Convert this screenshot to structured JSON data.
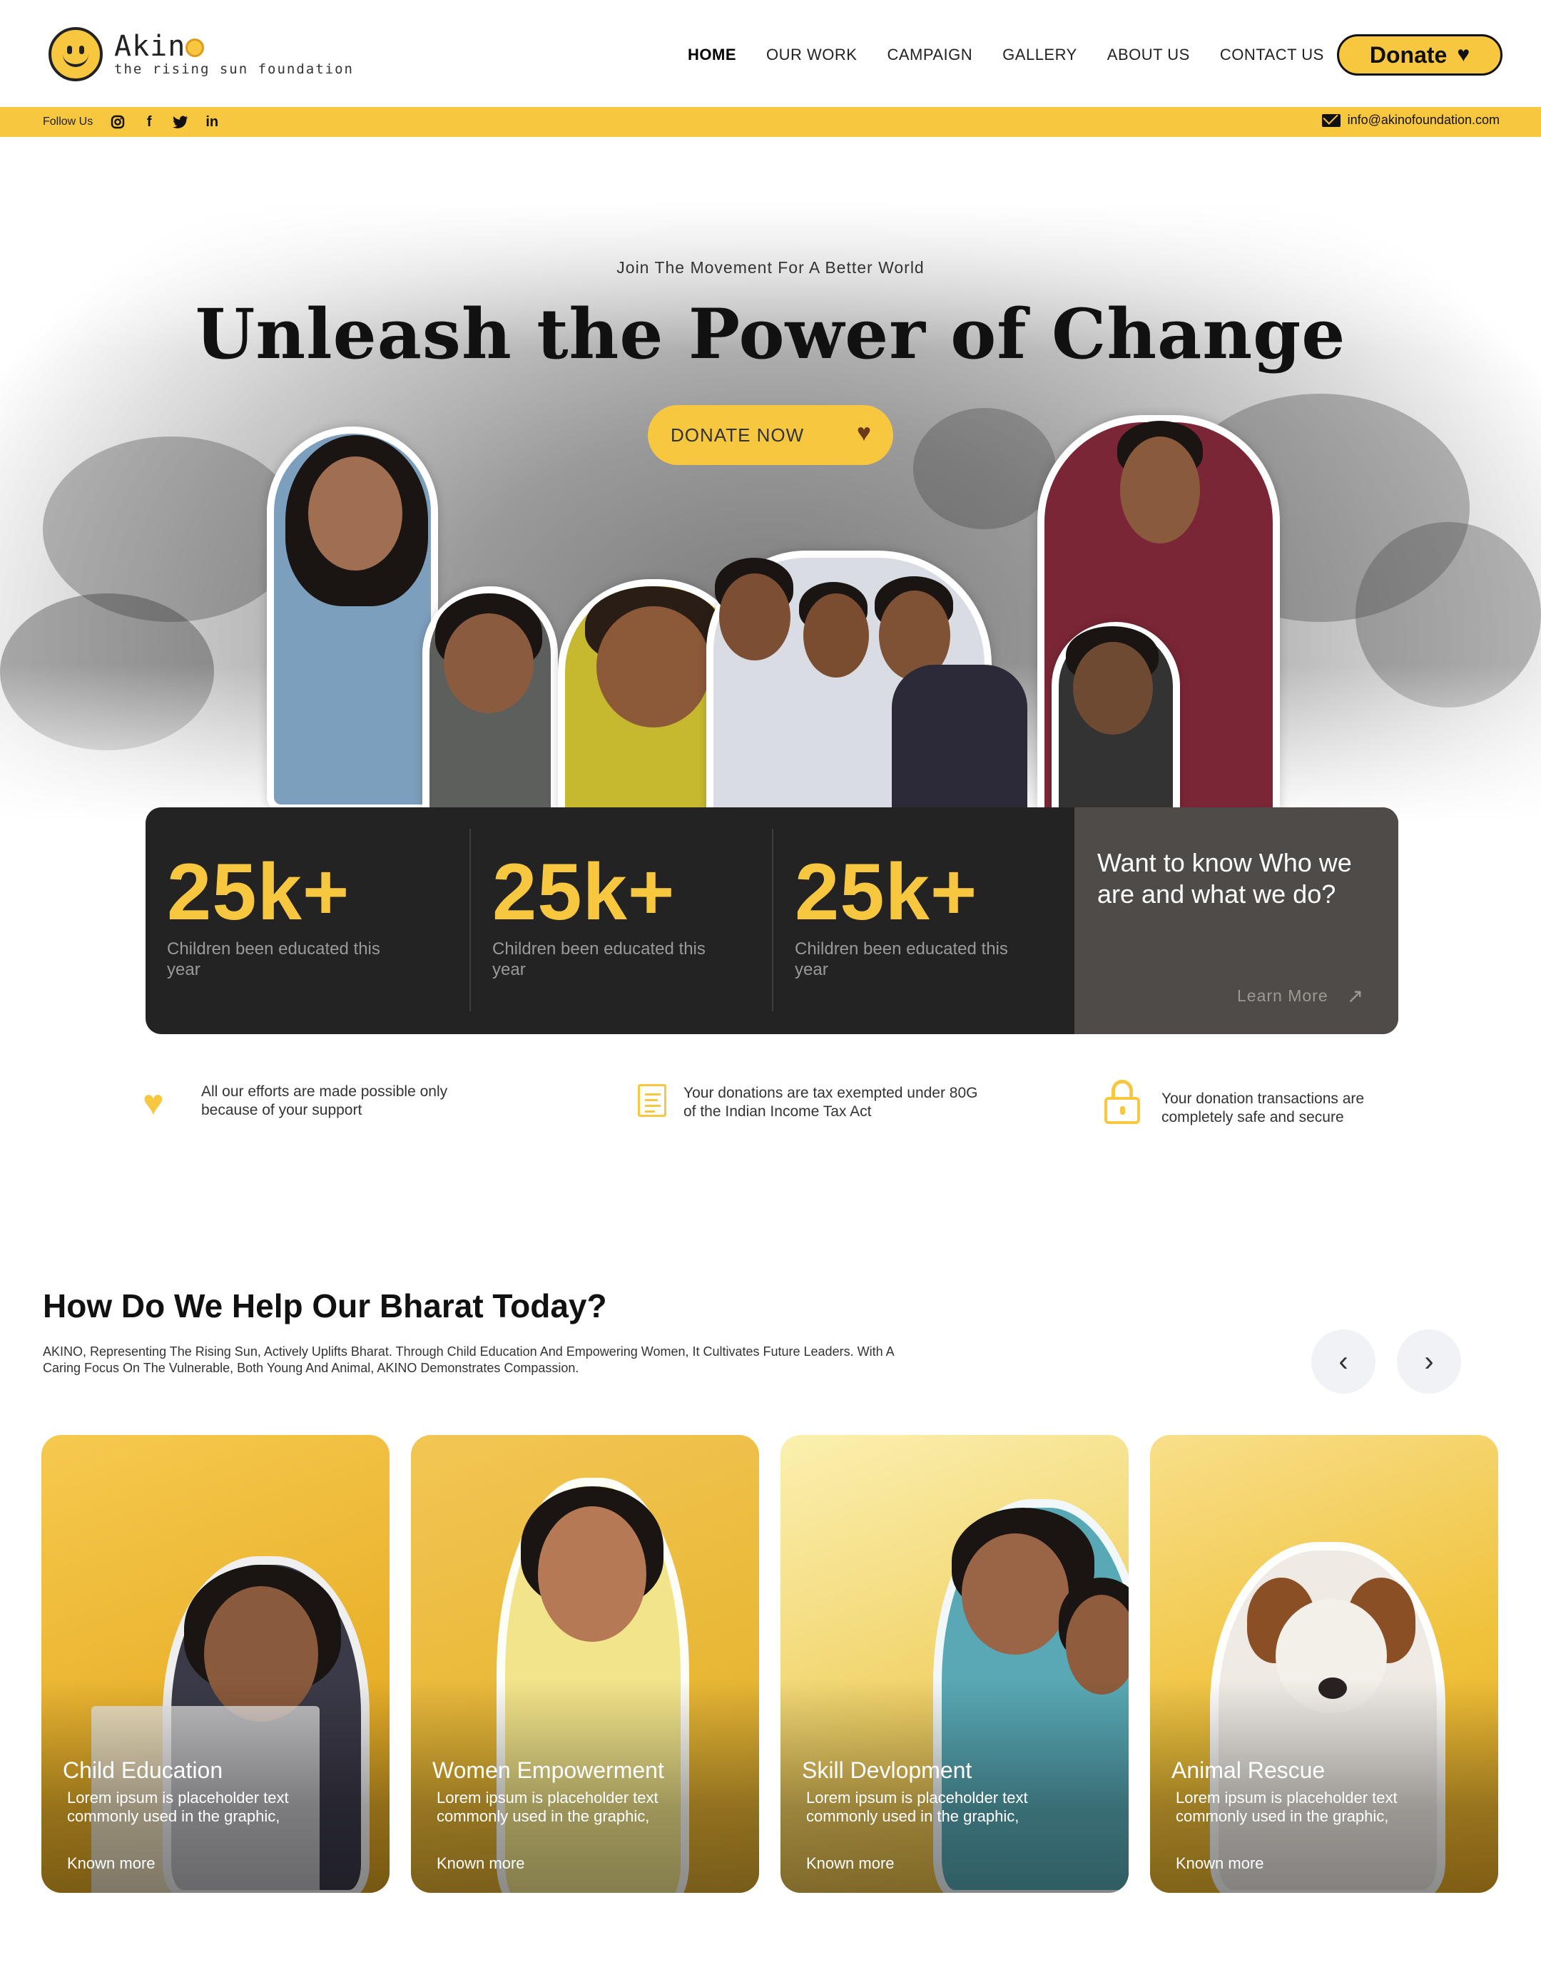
{
  "brand": {
    "name_prefix": "Akin",
    "tagline": "the rising sun foundation"
  },
  "nav": {
    "items": [
      "HOME",
      "OUR WORK",
      "CAMPAIGN",
      "GALLERY",
      "ABOUT US",
      "CONTACT US"
    ],
    "active": "HOME",
    "donate_label": "Donate"
  },
  "followbar": {
    "label": "Follow Us",
    "socials": [
      "instagram-icon",
      "facebook-icon",
      "twitter-icon",
      "linkedin-icon"
    ],
    "email": "info@akinofoundation.com"
  },
  "hero": {
    "kicker": "Join The Movement For A Better World",
    "title": "Unleash the Power of Change",
    "cta_label": "DONATE NOW"
  },
  "stats": {
    "items": [
      {
        "value": "25k+",
        "caption": "Children been educated this year"
      },
      {
        "value": "25k+",
        "caption": "Children been educated this year"
      },
      {
        "value": "25k+",
        "caption": "Children been educated this year"
      }
    ],
    "who": {
      "text": "Want to know Who we are and what we do?",
      "link": "Learn More"
    }
  },
  "trust": [
    {
      "icon": "heart-icon",
      "text": "All our efforts are made possible only because of your support"
    },
    {
      "icon": "document-icon",
      "text": "Your donations are tax exempted under 80G of the Indian Income Tax Act"
    },
    {
      "icon": "lock-icon",
      "text": "Your donation transactions are completely safe and secure"
    }
  ],
  "help": {
    "title": "How Do We Help Our Bharat Today?",
    "description": "AKINO, Representing The Rising Sun, Actively Uplifts Bharat. Through Child Education And Empowering Women, It Cultivates Future Leaders. With A Caring Focus On The Vulnerable, Both Young And Animal, AKINO Demonstrates Compassion.",
    "cards": [
      {
        "title": "Child Education",
        "text": "Lorem ipsum is placeholder text commonly used in the graphic,",
        "link": "Known more"
      },
      {
        "title": "Women Empowerment",
        "text": "Lorem ipsum is placeholder text commonly used in the graphic,",
        "link": "Known more"
      },
      {
        "title": "Skill Devlopment",
        "text": "Lorem ipsum is placeholder text commonly used in the graphic,",
        "link": "Known more"
      },
      {
        "title": "Animal Rescue",
        "text": "Lorem ipsum is placeholder text commonly used in the graphic,",
        "link": "Known more"
      }
    ]
  },
  "colors": {
    "accent": "#f7c740",
    "dark": "#232323",
    "panel": "#4e4b48"
  }
}
